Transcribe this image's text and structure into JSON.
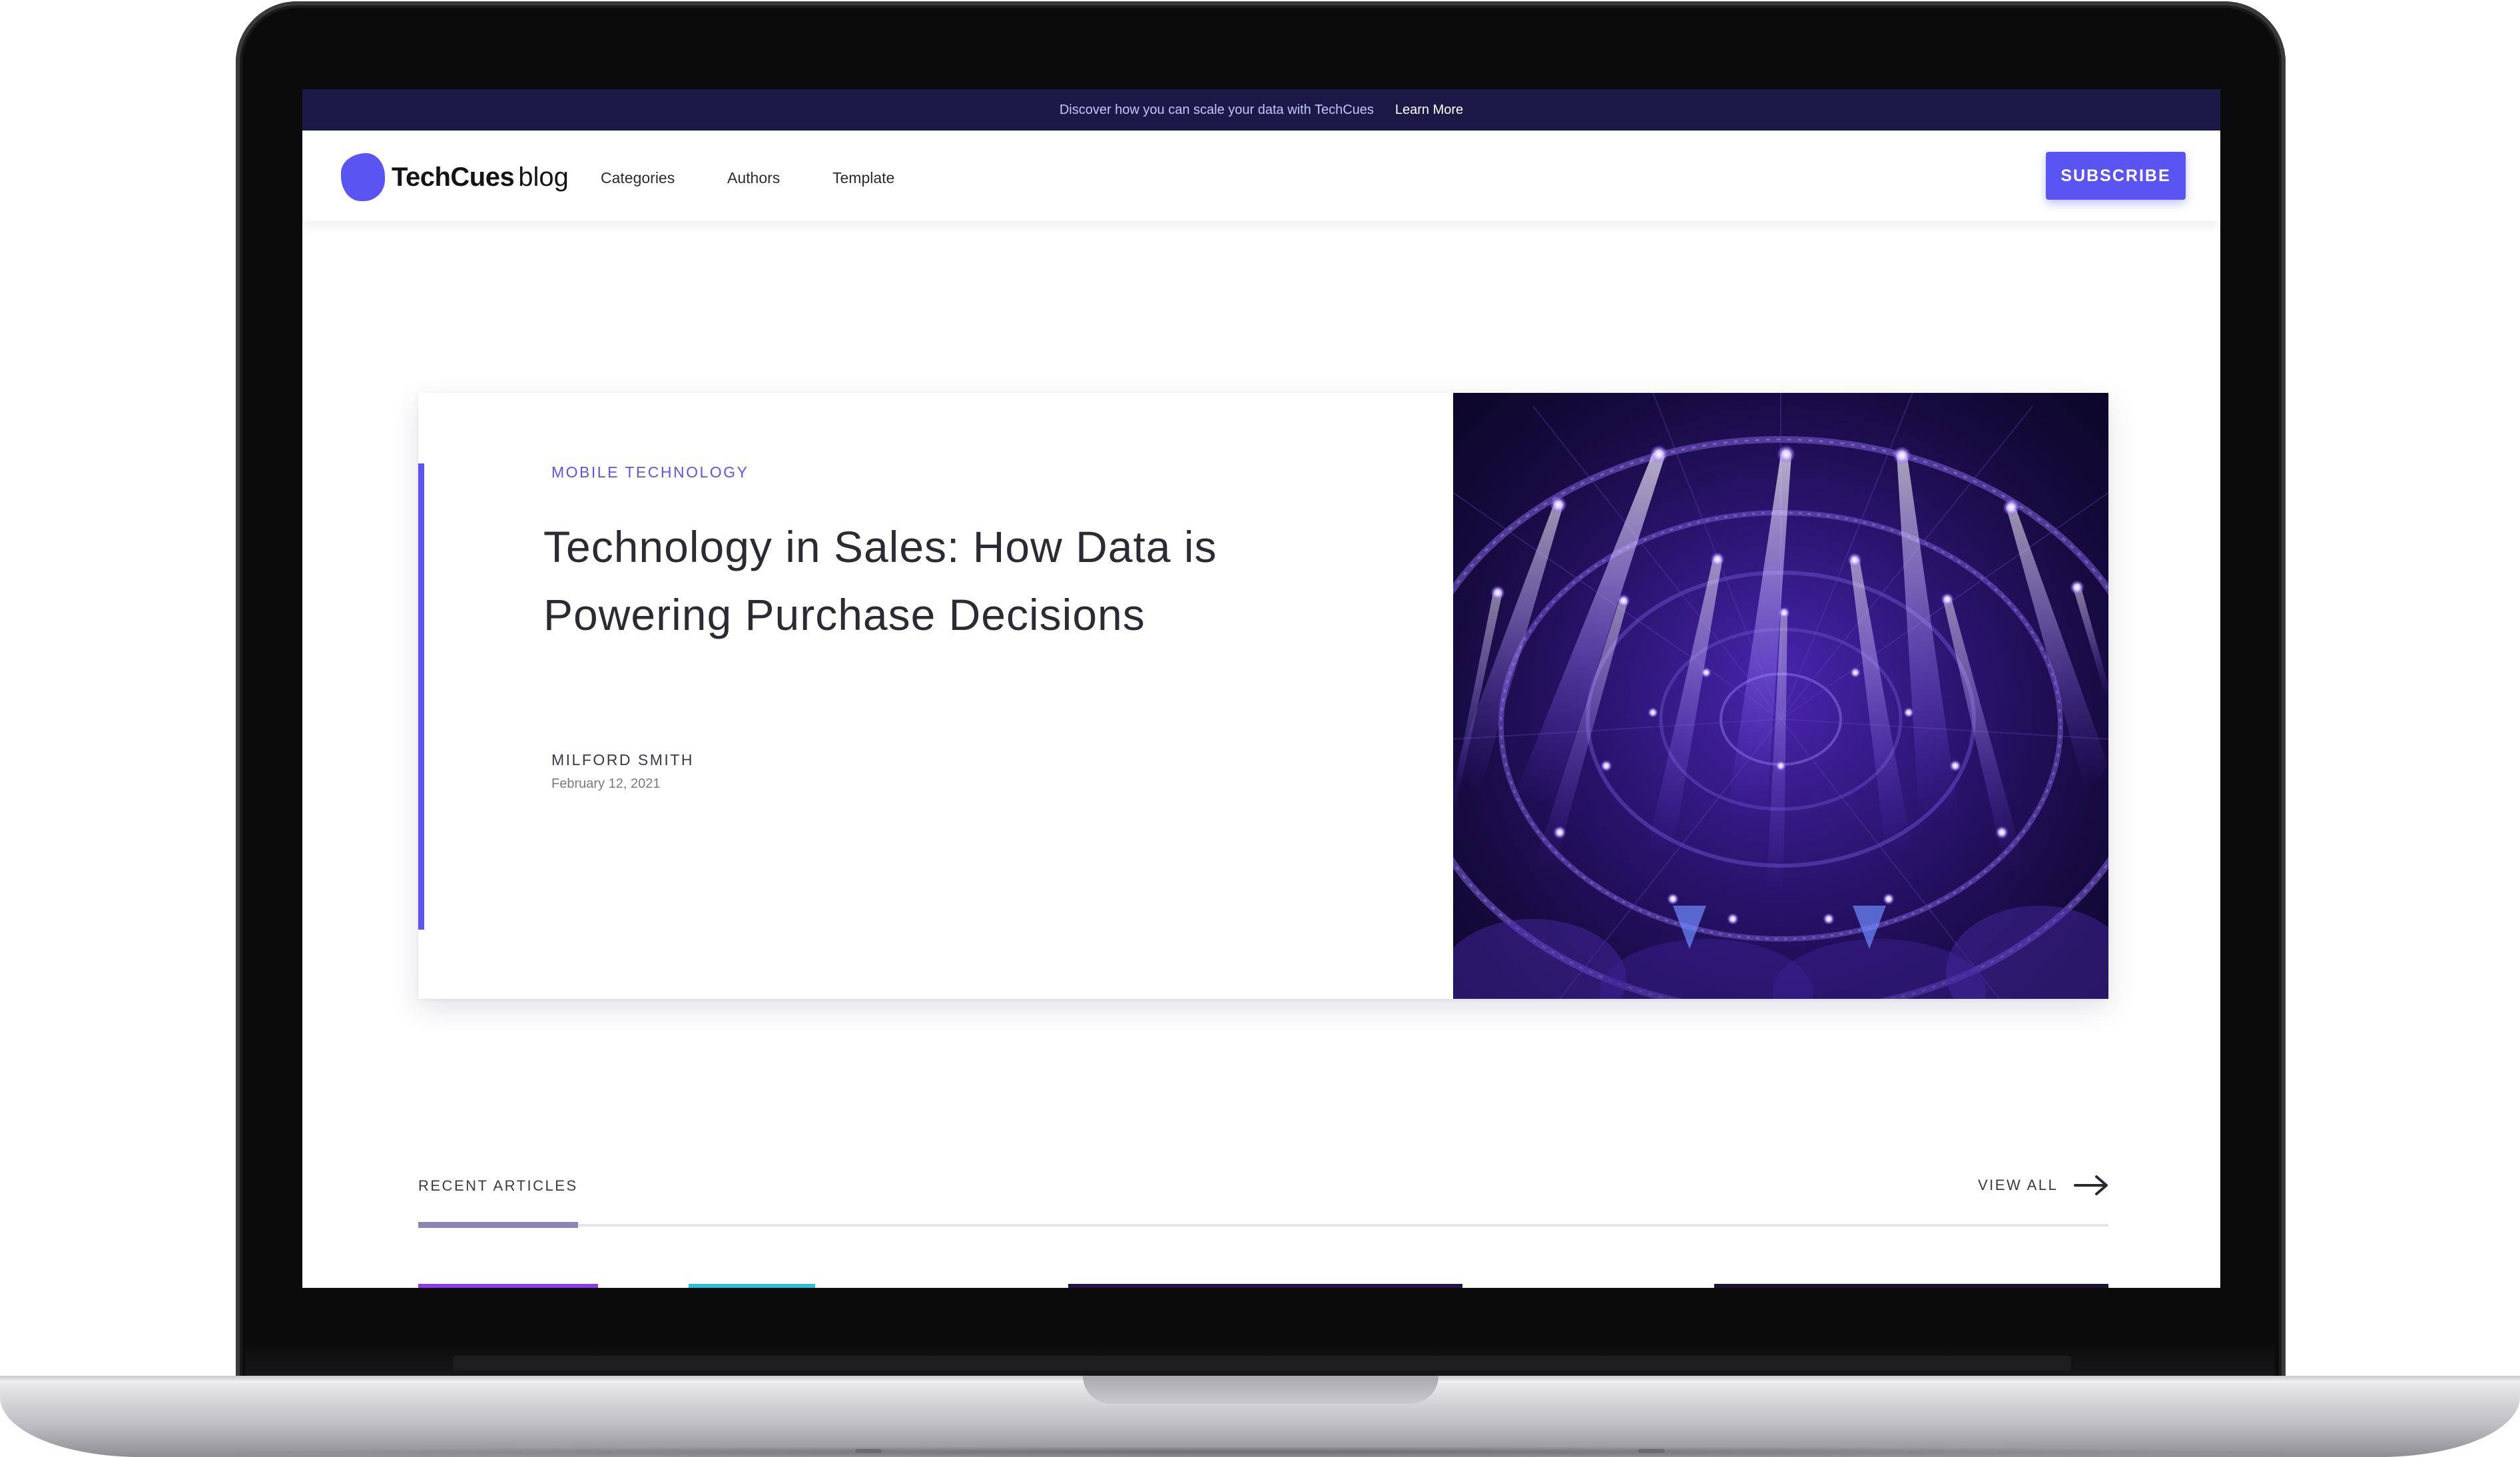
{
  "announcement": {
    "text": "Discover how you can scale your data with TechCues",
    "link": "Learn More"
  },
  "brand": {
    "name": "TechCues",
    "suffix": "blog",
    "accent_color": "#5a55f2"
  },
  "nav": {
    "links": [
      "Categories",
      "Authors",
      "Template"
    ],
    "subscribe_label": "SUBSCRIBE"
  },
  "featured": {
    "category": "MOBILE TECHNOLOGY",
    "title": "Technology in Sales: How Data is Powering Purchase Decisions",
    "author": "MILFORD SMITH",
    "date": "February 12, 2021",
    "image_description": "purple stage lights"
  },
  "recent": {
    "label": "RECENT ARTICLES",
    "view_all": "VIEW ALL"
  }
}
